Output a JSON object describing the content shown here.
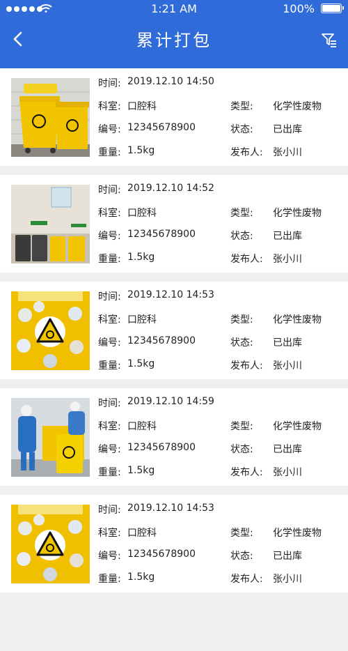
{
  "status_bar": {
    "time": "1:21 AM",
    "battery": "100%"
  },
  "header": {
    "title": "累计打包"
  },
  "labels": {
    "time": "时间:",
    "dept": "科室:",
    "number": "编号:",
    "weight": "重量:",
    "type": "类型:",
    "status": "状态:",
    "publisher": "发布人:"
  },
  "items": [
    {
      "image": "yellow-bins-photo",
      "time": "2019.12.10 14:50",
      "dept": "口腔科",
      "type": "化学性废物",
      "number": "12345678900",
      "status": "已出库",
      "weight": "1.5kg",
      "publisher": "张小川"
    },
    {
      "image": "waste-room-photo",
      "time": "2019.12.10 14:52",
      "dept": "口腔科",
      "type": "化学性废物",
      "number": "12345678900",
      "status": "已出库",
      "weight": "1.5kg",
      "publisher": "张小川"
    },
    {
      "image": "biohazard-poster",
      "time": "2019.12.10 14:53",
      "dept": "口腔科",
      "type": "化学性废物",
      "number": "12345678900",
      "status": "已出库",
      "weight": "1.5kg",
      "publisher": "张小川"
    },
    {
      "image": "workers-photo",
      "time": "2019.12.10 14:59",
      "dept": "口腔科",
      "type": "化学性废物",
      "number": "12345678900",
      "status": "已出库",
      "weight": "1.5kg",
      "publisher": "张小川"
    },
    {
      "image": "biohazard-poster",
      "time": "2019.12.10 14:53",
      "dept": "口腔科",
      "type": "化学性废物",
      "number": "12345678900",
      "status": "已出库",
      "weight": "1.5kg",
      "publisher": "张小川"
    }
  ]
}
